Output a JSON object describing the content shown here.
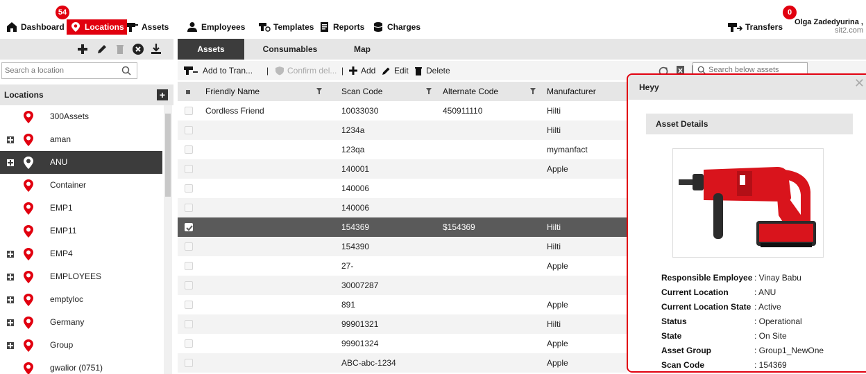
{
  "nav": {
    "dashboard": "Dashboard",
    "dashboard_badge": "54",
    "locations": "Locations",
    "assets": "Assets",
    "employees": "Employees",
    "templates": "Templates",
    "reports": "Reports",
    "charges": "Charges",
    "transfers": "Transfers",
    "transfers_badge": "0",
    "user_name": "Olga Zadedyurina ,",
    "user_org": "sit2.com"
  },
  "left": {
    "search_placeholder": "Search a location",
    "header": "Locations",
    "items": [
      {
        "label": "300Assets",
        "expandable": false
      },
      {
        "label": "aman",
        "expandable": true
      },
      {
        "label": "ANU",
        "expandable": true,
        "selected": true
      },
      {
        "label": "Container",
        "expandable": false
      },
      {
        "label": "EMP1",
        "expandable": false
      },
      {
        "label": "EMP11",
        "expandable": false
      },
      {
        "label": "EMP4",
        "expandable": true
      },
      {
        "label": "EMPLOYEES",
        "expandable": true
      },
      {
        "label": "emptyloc",
        "expandable": true
      },
      {
        "label": "Germany",
        "expandable": true
      },
      {
        "label": "Group",
        "expandable": true
      },
      {
        "label": "gwalior (0751)",
        "expandable": false
      }
    ]
  },
  "tabs": [
    "Assets",
    "Consumables",
    "Map"
  ],
  "actions": {
    "add_to_transfer": "Add to Tran...",
    "sep1": "|",
    "confirm_delivery": "Confirm del...",
    "sep2": "|",
    "add": "Add",
    "edit": "Edit",
    "delete": "Delete",
    "search_placeholder": "Search below assets"
  },
  "grid": {
    "columns": [
      "Friendly Name",
      "Scan Code",
      "Alternate Code",
      "Manufacturer"
    ],
    "rows": [
      {
        "name": "Cordless Friend",
        "scan": "10033030",
        "alt": "450911110",
        "mfr": "Hilti"
      },
      {
        "name": "",
        "scan": "1234a",
        "alt": "",
        "mfr": "Hilti"
      },
      {
        "name": "",
        "scan": "123qa",
        "alt": "",
        "mfr": "mymanfact"
      },
      {
        "name": "",
        "scan": "140001",
        "alt": "",
        "mfr": "Apple"
      },
      {
        "name": "",
        "scan": "140006",
        "alt": "",
        "mfr": ""
      },
      {
        "name": "",
        "scan": "140006",
        "alt": "",
        "mfr": ""
      },
      {
        "name": "",
        "scan": "154369",
        "alt": "$154369",
        "mfr": "Hilti",
        "selected": true
      },
      {
        "name": "",
        "scan": "154390",
        "alt": "",
        "mfr": "Hilti"
      },
      {
        "name": "",
        "scan": "27-",
        "alt": "",
        "mfr": "Apple"
      },
      {
        "name": "",
        "scan": "30007287",
        "alt": "",
        "mfr": ""
      },
      {
        "name": "",
        "scan": "891",
        "alt": "",
        "mfr": "Apple"
      },
      {
        "name": "",
        "scan": "99901321",
        "alt": "",
        "mfr": "Hilti"
      },
      {
        "name": "",
        "scan": "99901324",
        "alt": "",
        "mfr": "Apple"
      },
      {
        "name": "",
        "scan": "ABC-abc-1234",
        "alt": "",
        "mfr": "Apple"
      }
    ]
  },
  "detail": {
    "title": "Heyy",
    "section": "Asset Details",
    "props": [
      {
        "k": "Responsible Employee",
        "v": ": Vinay Babu"
      },
      {
        "k": "Current Location",
        "v": ": ANU"
      },
      {
        "k": "Current Location State",
        "v": ": Active"
      },
      {
        "k": "Status",
        "v": ": Operational"
      },
      {
        "k": "State",
        "v": ": On Site"
      },
      {
        "k": "Asset Group",
        "v": ": Group1_NewOne"
      },
      {
        "k": "Scan Code",
        "v": ": 154369"
      }
    ]
  },
  "colors": {
    "accent": "#e1000f",
    "dark": "#3c3c3c",
    "panel": "#e6e6e6"
  }
}
